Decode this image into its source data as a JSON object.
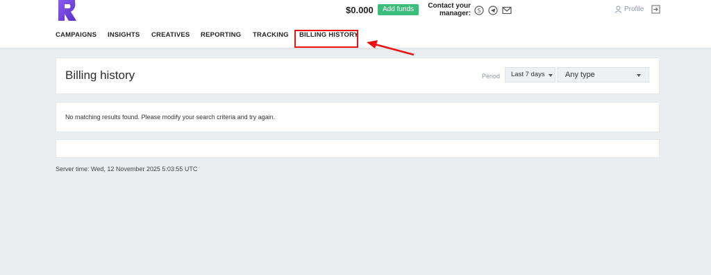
{
  "header": {
    "balance": "$0.000",
    "add_funds_label": "Add funds",
    "contact_label_line1": "Contact your",
    "contact_label_line2": "manager:",
    "contact_icons": [
      "skype-icon",
      "telegram-icon",
      "mail-icon"
    ],
    "profile_label": "Profile"
  },
  "nav": {
    "items": [
      {
        "label": "CAMPAIGNS"
      },
      {
        "label": "INSIGHTS"
      },
      {
        "label": "CREATIVES"
      },
      {
        "label": "REPORTING"
      },
      {
        "label": "TRACKING"
      },
      {
        "label": "BILLING HISTORY",
        "active": true
      }
    ]
  },
  "page": {
    "title": "Billing history",
    "period_label": "Period",
    "period_value": "Last 7 days",
    "type_value": "Any type",
    "empty_message": "No matching results found. Please modify your search criteria and try again.",
    "server_time": "Server time: Wed, 12 November 2025 5:03:55 UTC"
  },
  "colors": {
    "accent": "#3dbd7d",
    "logo": "#6b3fd6",
    "highlight": "#e11111"
  }
}
